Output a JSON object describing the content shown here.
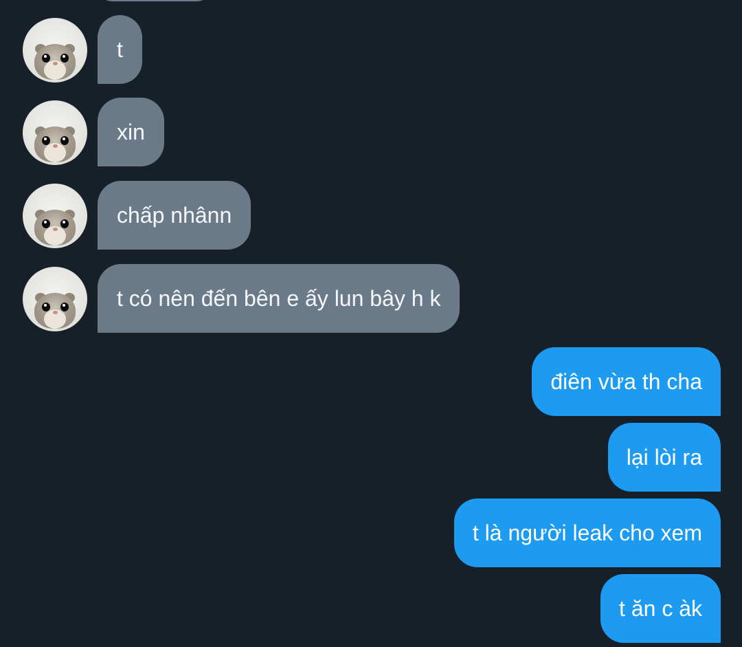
{
  "conversation": {
    "incoming": [
      {
        "text": "t",
        "avatar_icon": "hamster-avatar-icon"
      },
      {
        "text": "xin",
        "avatar_icon": "hamster-avatar-icon"
      },
      {
        "text": "chấp nhânn",
        "avatar_icon": "hamster-avatar-icon"
      },
      {
        "text": "t có nên đến bên e ấy lun bây h k",
        "avatar_icon": "hamster-avatar-icon"
      }
    ],
    "outgoing": [
      {
        "text": "điên vừa th cha"
      },
      {
        "text": "lại lòi ra"
      },
      {
        "text": "t là người leak cho xem"
      },
      {
        "text": "t ăn c àk"
      }
    ]
  },
  "colors": {
    "background": "#171f29",
    "incoming_bubble": "#6b7a89",
    "outgoing_bubble": "#1d9bf0",
    "text": "#ffffff"
  }
}
